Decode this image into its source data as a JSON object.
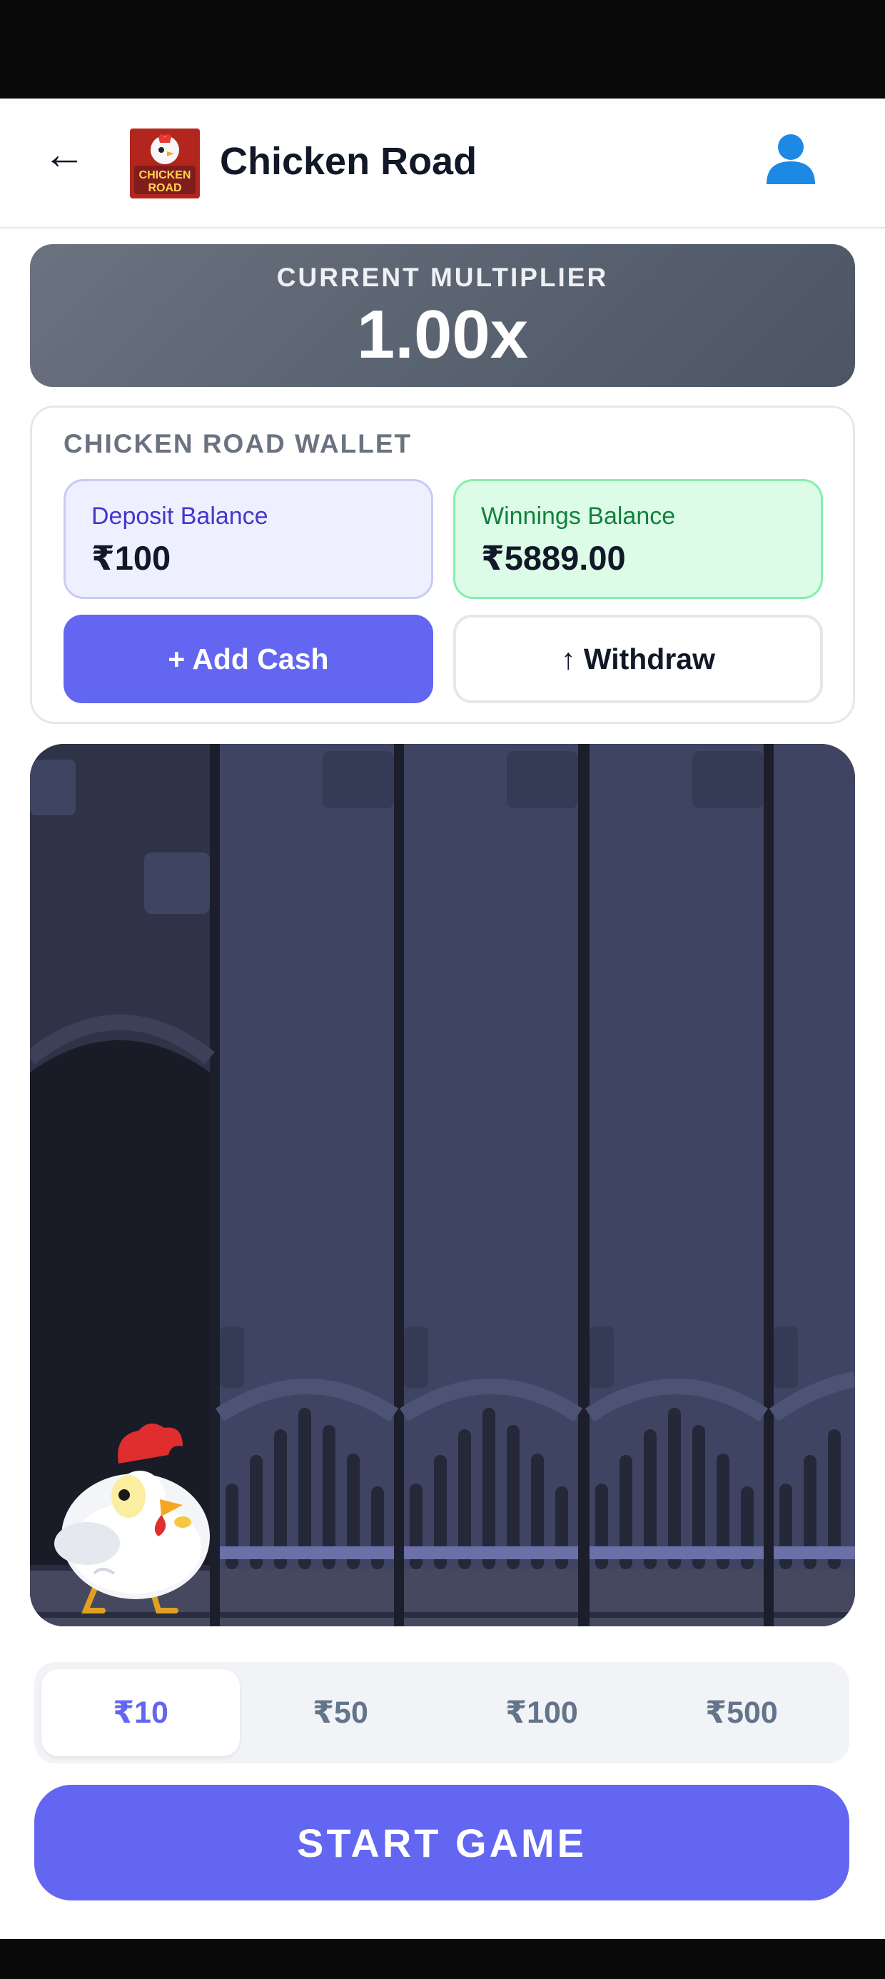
{
  "header": {
    "back_icon": "←",
    "title": "Chicken Road",
    "logo_text": [
      "CHICKEN",
      "ROAD"
    ],
    "user_icon": "user-icon"
  },
  "multiplier": {
    "label": "CURRENT MULTIPLIER",
    "value": "1.00x"
  },
  "wallet": {
    "title": "CHICKEN ROAD WALLET",
    "deposit": {
      "label": "Deposit Balance",
      "value": "₹100"
    },
    "winnings": {
      "label": "Winnings Balance",
      "value": "₹5889.00"
    },
    "add_cash_label": "+ Add Cash",
    "withdraw_label": "↑ Withdraw"
  },
  "bets": {
    "options": [
      "₹10",
      "₹50",
      "₹100",
      "₹500"
    ],
    "selected": "₹10"
  },
  "start_label": "START GAME",
  "colors": {
    "accent": "#6366f1",
    "multiplier_bg": "#6b7280",
    "winnings_bg": "#dcfce7",
    "deposit_bg": "#eef0ff",
    "lane": "#3e4462",
    "lane_dark": "#1c1e2c"
  }
}
